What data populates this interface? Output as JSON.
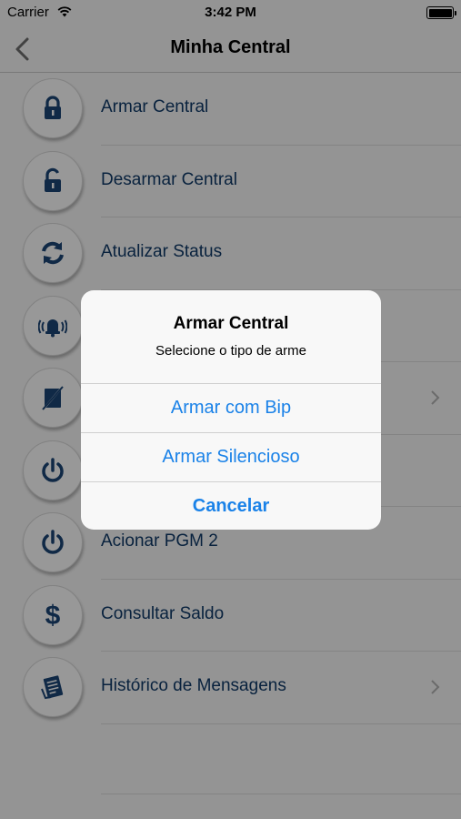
{
  "status_bar": {
    "carrier": "Carrier",
    "time": "3:42 PM"
  },
  "nav": {
    "title": "Minha Central"
  },
  "menu": [
    {
      "label": "Armar Central",
      "icon": "lock-closed-icon"
    },
    {
      "label": "Desarmar Central",
      "icon": "lock-open-icon"
    },
    {
      "label": "Atualizar Status",
      "icon": "refresh-icon"
    },
    {
      "label": "",
      "icon": "alarm-bell-icon"
    },
    {
      "label": "",
      "icon": "sensor-icon"
    },
    {
      "label": "",
      "icon": "power-icon"
    },
    {
      "label": "Acionar PGM 2",
      "icon": "power-icon"
    },
    {
      "label": "Consultar Saldo",
      "icon": "dollar-icon"
    },
    {
      "label": "Histórico de Mensagens",
      "icon": "message-history-icon"
    }
  ],
  "alert": {
    "title": "Armar Central",
    "message": "Selecione o tipo de arme",
    "buttons": [
      "Armar com Bip",
      "Armar Silencioso",
      "Cancelar"
    ]
  },
  "colors": {
    "label": "#0f3a68",
    "icon": "#1b4576",
    "alert_button": "#1a82e8"
  }
}
